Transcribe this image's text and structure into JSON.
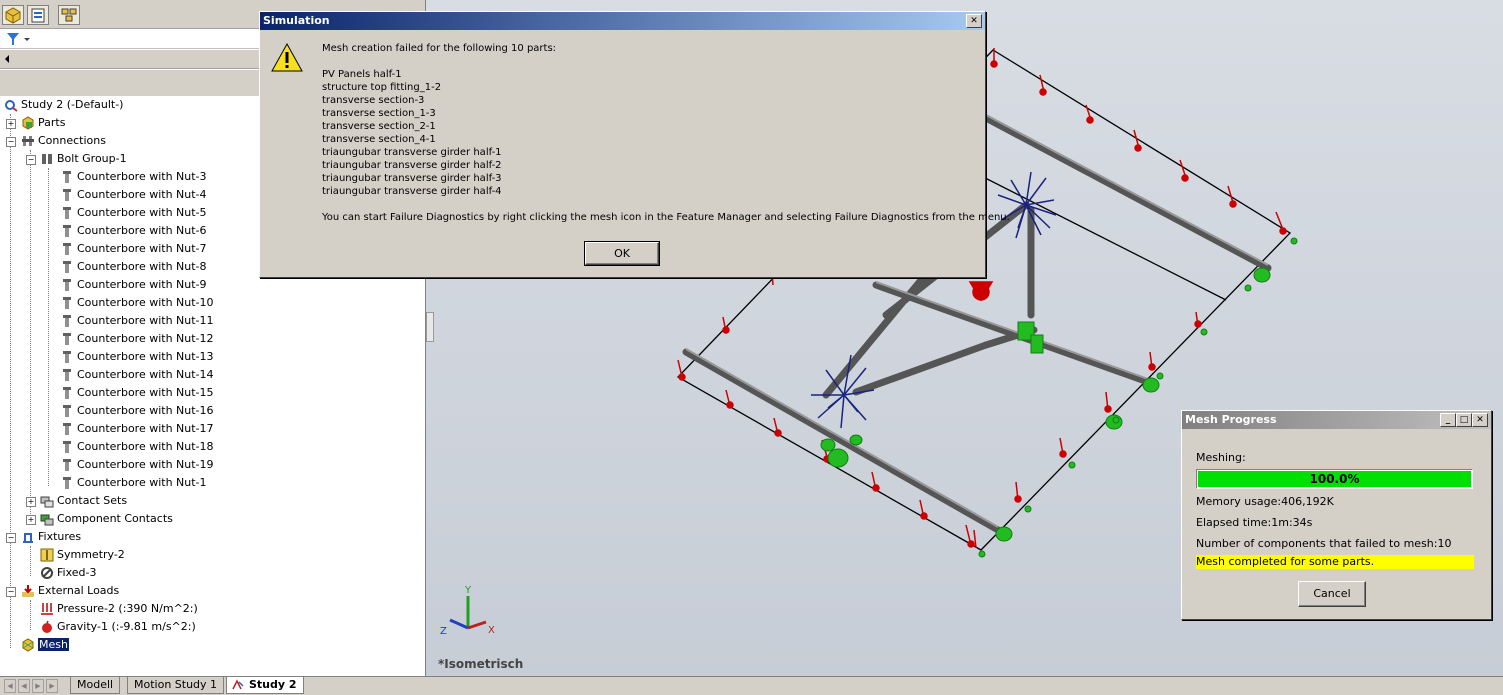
{
  "sidebar": {
    "tree": {
      "root": "Study 2 (-Default-)",
      "parts": "Parts",
      "connections": "Connections",
      "bolt_group": "Bolt Group-1",
      "bolts": [
        "Counterbore with Nut-3",
        "Counterbore with Nut-4",
        "Counterbore with Nut-5",
        "Counterbore with Nut-6",
        "Counterbore with Nut-7",
        "Counterbore with Nut-8",
        "Counterbore with Nut-9",
        "Counterbore with Nut-10",
        "Counterbore with Nut-11",
        "Counterbore with Nut-12",
        "Counterbore with Nut-13",
        "Counterbore with Nut-14",
        "Counterbore with Nut-15",
        "Counterbore with Nut-16",
        "Counterbore with Nut-17",
        "Counterbore with Nut-18",
        "Counterbore with Nut-19",
        "Counterbore with Nut-1"
      ],
      "contact_sets": "Contact Sets",
      "component_contacts": "Component Contacts",
      "fixtures": "Fixtures",
      "symmetry": "Symmetry-2",
      "fixed": "Fixed-3",
      "external_loads": "External Loads",
      "pressure": "Pressure-2 (:390 N/m^2:)",
      "gravity": "Gravity-1 (:-9.81 m/s^2:)",
      "mesh": "Mesh"
    }
  },
  "simulation_dialog": {
    "title": "Simulation",
    "message": "Mesh creation failed for the following 10 parts:",
    "failed_parts": [
      "PV Panels half-1",
      "structure top fitting_1-2",
      "transverse section-3",
      "transverse section_1-3",
      "transverse section_2-1",
      "transverse section_4-1",
      "triaungubar transverse girder half-1",
      "triaungubar transverse girder half-2",
      "triaungubar transverse girder half-3",
      "triaungubar transverse girder half-4"
    ],
    "hint": "You can start Failure Diagnostics by right clicking the mesh icon in the Feature Manager and selecting Failure Diagnostics from the menu.",
    "ok_label": "OK",
    "close_glyph": "✕"
  },
  "mesh_progress": {
    "title": "Mesh Progress",
    "meshing_label": "Meshing:",
    "progress_text": "100.0%",
    "progress_value": 1.0,
    "memory": "Memory usage:406,192K",
    "elapsed": "Elapsed time:1m:34s",
    "failed_count": "Number of components that failed to mesh:10",
    "status": "Mesh completed for some parts.",
    "cancel_label": "Cancel",
    "status_color": "#ffff00",
    "bar_color": "#00e000"
  },
  "viewport": {
    "view_name": "*Isometrisch",
    "triad": {
      "x": "X",
      "y": "Y",
      "z": "Z"
    }
  },
  "bottom_tabs": [
    "Modell",
    "Motion Study 1",
    "Study 2"
  ],
  "colors": {
    "title_active": "#0a246a",
    "selection": "#0a246a",
    "load_arrow": "#cc0000",
    "fixture": "#22bb22",
    "bolt_cluster": "#1a237e"
  }
}
